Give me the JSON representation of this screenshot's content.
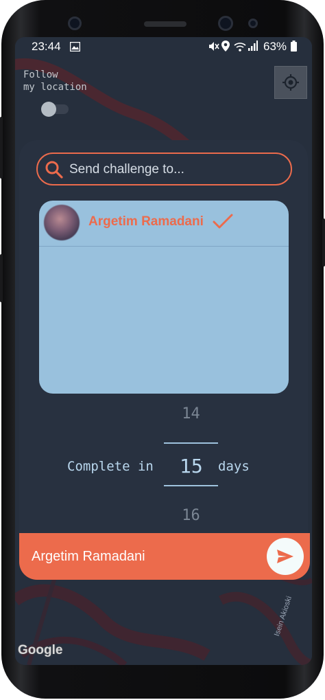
{
  "status_bar": {
    "time": "23:44",
    "notification_icon": "image-icon",
    "status_icons": [
      "mute-icon",
      "location-icon",
      "wifi-icon",
      "signal-icon"
    ],
    "battery": "63%"
  },
  "map": {
    "follow_label": "Follow\nmy location",
    "follow_toggle": "off",
    "locate_button_icon": "crosshair-icon",
    "attribution": "Google",
    "watermark": "Isein Akioski"
  },
  "sheet": {
    "search": {
      "placeholder": "Send challenge to...",
      "value": ""
    },
    "contacts": [
      {
        "name": "Argetim Ramadani",
        "selected": true
      }
    ],
    "duration": {
      "prefix": "Complete in",
      "previous": "14",
      "selected": "15",
      "next": "16",
      "suffix": "days"
    },
    "recipient": "Argetim Ramadani",
    "send_icon": "send-icon"
  },
  "colors": {
    "accent": "#ec6b4c",
    "sheet_bg": "#283140",
    "list_bg": "#99c1dd",
    "picker_text": "#b9d7ee"
  }
}
